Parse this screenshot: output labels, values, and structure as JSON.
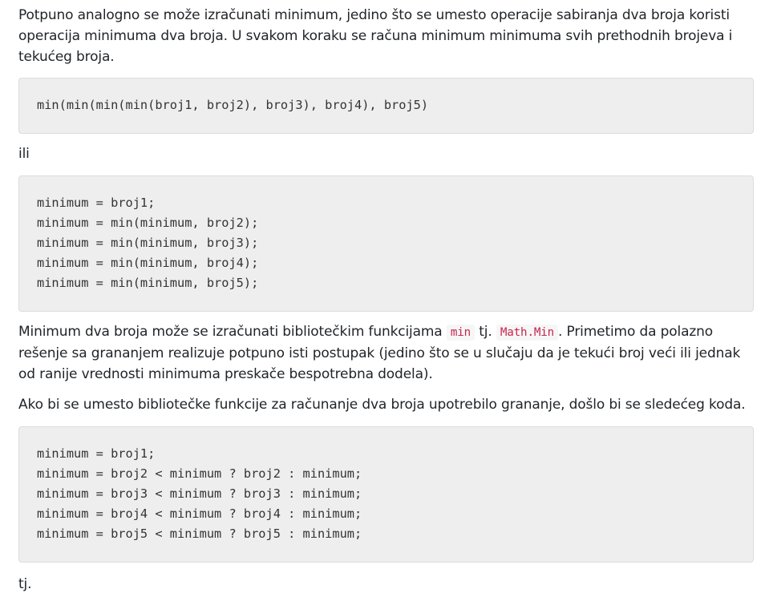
{
  "paragraphs": {
    "intro": "Potpuno analogno se može izračunati minimum, jedino što se umesto operacije sabiranja dva broja koristi operacija minimuma dva broja. U svakom koraku se računa minimum minimuma svih prethodnih brojeva i tekućeg broja.",
    "ili": "ili",
    "library_pre": "Minimum dva broja može se izračunati bibliotečkim funkcijama ",
    "library_code1": "min",
    "library_mid": " tj. ",
    "library_code2": "Math.Min",
    "library_post": ". Primetimo da polazno rešenje sa grananjem realizuje potpuno isti postupak (jedino što se u slučaju da je tekući broj veći ili jednak od ranije vrednosti minimuma preskače bespotrebna dodela).",
    "branching": "Ako bi se umesto bibliotečke funkcije za računanje dva broja upotrebilo grananje, došlo bi se sledećeg koda.",
    "tj": "tj."
  },
  "code_blocks": {
    "nested": "min(min(min(min(broj1, broj2), broj3), broj4), broj5)",
    "sequential": "minimum = broj1;\nminimum = min(minimum, broj2);\nminimum = min(minimum, broj3);\nminimum = min(minimum, broj4);\nminimum = min(minimum, broj5);",
    "ternary": "minimum = broj1;\nminimum = broj2 < minimum ? broj2 : minimum;\nminimum = broj3 < minimum ? broj3 : minimum;\nminimum = broj4 < minimum ? broj4 : minimum;\nminimum = broj5 < minimum ? broj5 : minimum;"
  }
}
